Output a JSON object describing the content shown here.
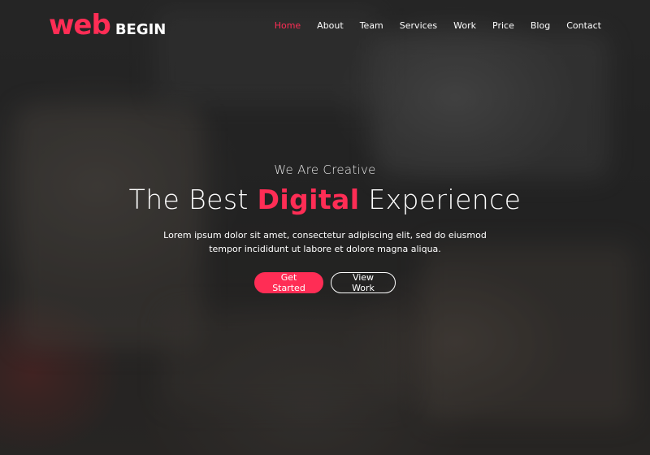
{
  "brand": {
    "logo_primary": "web",
    "logo_secondary": "BEGIN",
    "accent_color": "#ff2d55"
  },
  "nav": {
    "items": [
      "Home",
      "About",
      "Team",
      "Services",
      "Work",
      "Price",
      "Blog",
      "Contact"
    ],
    "active": "Home"
  },
  "hero": {
    "kicker": "We Are Creative",
    "headline_before": "The Best",
    "headline_highlight": "Digital",
    "headline_after": "Experience",
    "description": "Lorem ipsum dolor sit amet, consectetur adipiscing elit, sed do eiusmod tempor incididunt ut labore et dolore magna aliqua.",
    "primary_button": "Get Started",
    "secondary_button": "View Work"
  }
}
